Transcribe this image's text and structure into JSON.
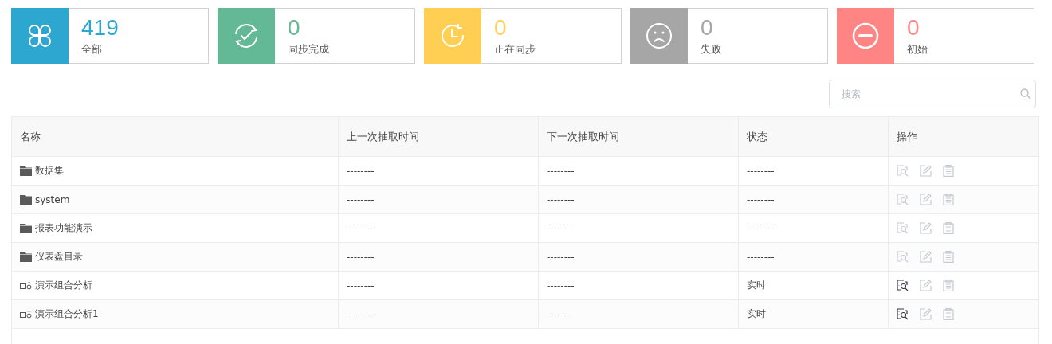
{
  "stats": [
    {
      "kind": "all",
      "count": "419",
      "label": "全部",
      "color": "#2ea7d0"
    },
    {
      "kind": "done",
      "count": "0",
      "label": "同步完成",
      "color": "#63b995"
    },
    {
      "kind": "syncing",
      "count": "0",
      "label": "正在同步",
      "color": "#ffcf54"
    },
    {
      "kind": "failed",
      "count": "0",
      "label": "失败",
      "color": "#a6a6a6"
    },
    {
      "kind": "initial",
      "count": "0",
      "label": "初始",
      "color": "#ff8585"
    }
  ],
  "search": {
    "placeholder": "搜索"
  },
  "table": {
    "columns": [
      "名称",
      "上一次抽取时间",
      "下一次抽取时间",
      "状态",
      "操作"
    ],
    "rows": [
      {
        "kind": "folder",
        "name": "数据集",
        "last": "--------",
        "next": "--------",
        "status": "--------",
        "actions": [
          {
            "kind": "preview",
            "disabled": true
          },
          {
            "kind": "edit",
            "disabled": true
          },
          {
            "kind": "log",
            "disabled": true
          }
        ]
      },
      {
        "kind": "folder",
        "name": "system",
        "last": "--------",
        "next": "--------",
        "status": "--------",
        "actions": [
          {
            "kind": "preview",
            "disabled": true
          },
          {
            "kind": "edit",
            "disabled": true
          },
          {
            "kind": "log",
            "disabled": true
          }
        ]
      },
      {
        "kind": "folder",
        "name": "报表功能演示",
        "last": "--------",
        "next": "--------",
        "status": "--------",
        "actions": [
          {
            "kind": "preview",
            "disabled": true
          },
          {
            "kind": "edit",
            "disabled": true
          },
          {
            "kind": "log",
            "disabled": true
          }
        ]
      },
      {
        "kind": "folder",
        "name": "仪表盘目录",
        "last": "--------",
        "next": "--------",
        "status": "--------",
        "actions": [
          {
            "kind": "preview",
            "disabled": true
          },
          {
            "kind": "edit",
            "disabled": true
          },
          {
            "kind": "log",
            "disabled": true
          }
        ]
      },
      {
        "kind": "analysis",
        "name": "演示组合分析",
        "last": "--------",
        "next": "--------",
        "status": "实时",
        "actions": [
          {
            "kind": "preview",
            "disabled": false
          },
          {
            "kind": "edit",
            "disabled": true
          },
          {
            "kind": "log",
            "disabled": true
          }
        ]
      },
      {
        "kind": "analysis",
        "name": "演示组合分析1",
        "last": "--------",
        "next": "--------",
        "status": "实时",
        "actions": [
          {
            "kind": "preview",
            "disabled": false
          },
          {
            "kind": "edit",
            "disabled": true
          },
          {
            "kind": "log",
            "disabled": true
          }
        ]
      }
    ]
  }
}
